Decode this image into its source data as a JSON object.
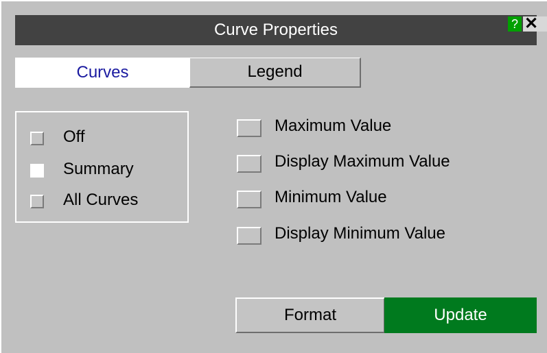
{
  "window": {
    "title": "Curve Properties",
    "help_label": "?",
    "close_label": "✕"
  },
  "tabs": [
    {
      "label": "Curves",
      "active": true
    },
    {
      "label": "Legend",
      "active": false
    }
  ],
  "summary_group": {
    "options": [
      {
        "label": "Off",
        "selected": false
      },
      {
        "label": "Summary",
        "selected": true
      },
      {
        "label": "All Curves",
        "selected": false
      }
    ]
  },
  "value_options": [
    {
      "label": "Maximum Value",
      "checked": false
    },
    {
      "label": "Display Maximum Value",
      "checked": false
    },
    {
      "label": "Minimum Value",
      "checked": false
    },
    {
      "label": "Display Minimum Value",
      "checked": false
    }
  ],
  "buttons": {
    "format_label": "Format",
    "update_label": "Update"
  },
  "colors": {
    "panel_bg": "#c0c0c0",
    "titlebar_bg": "#424242",
    "active_tab_text": "#1a1aa0",
    "update_bg": "#007a1e",
    "help_bg": "#00a000"
  }
}
